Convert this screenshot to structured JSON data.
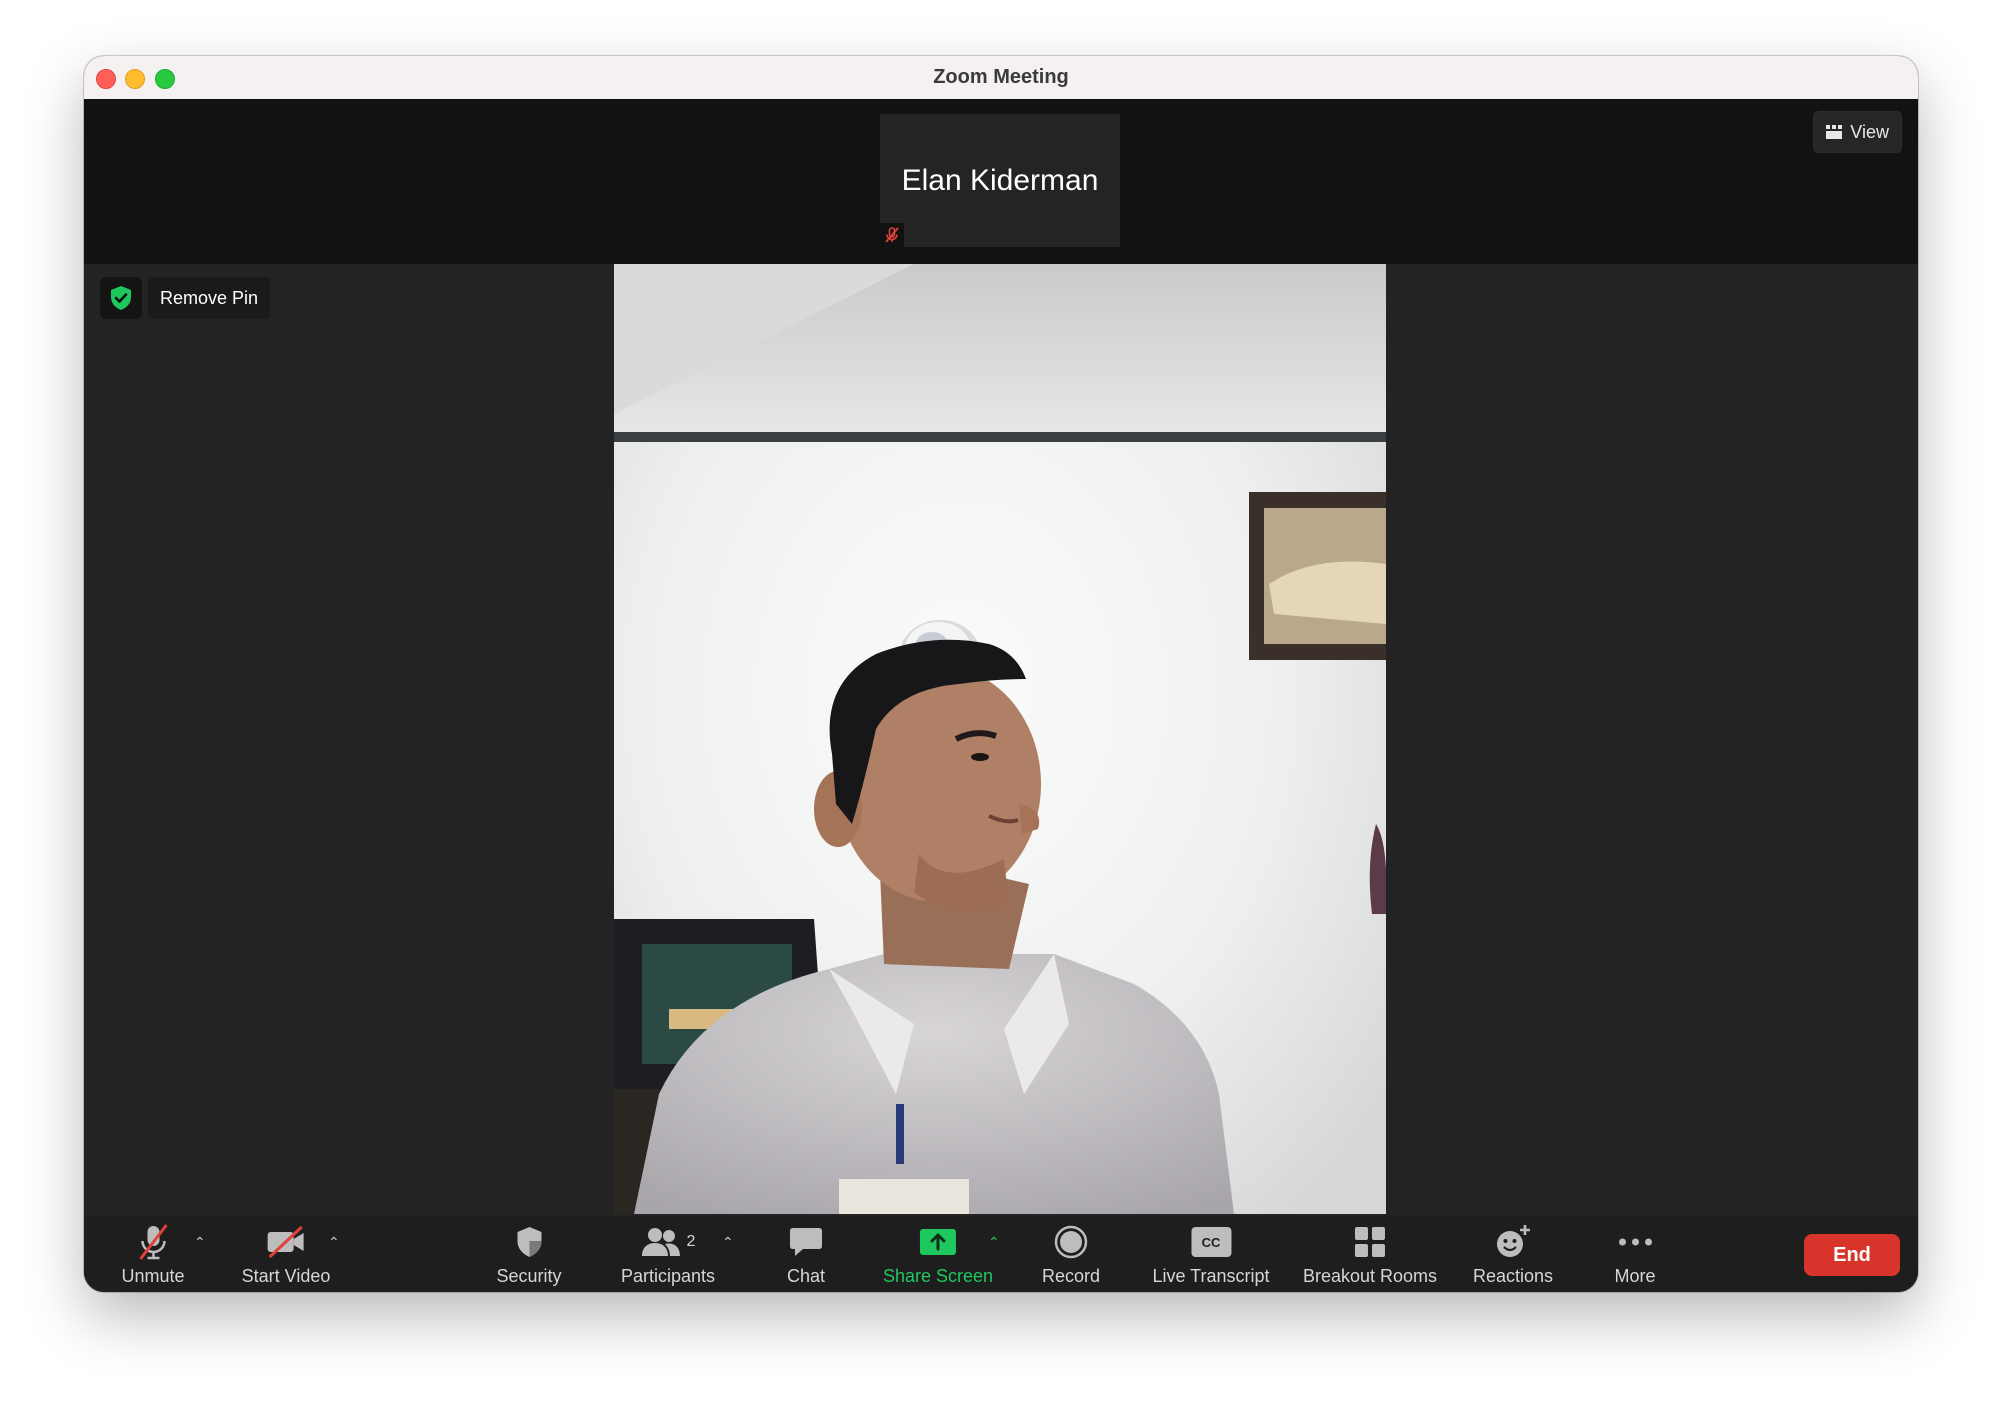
{
  "window": {
    "title": "Zoom Meeting"
  },
  "strip": {
    "participant_name": "Elan Kiderman",
    "view_label": "View"
  },
  "pin": {
    "label": "Remove Pin"
  },
  "toolbar": {
    "unmute": "Unmute",
    "start_video": "Start Video",
    "security": "Security",
    "participants": "Participants",
    "participants_count": "2",
    "chat": "Chat",
    "share_screen": "Share Screen",
    "record": "Record",
    "live_transcript": "Live Transcript",
    "breakout_rooms": "Breakout Rooms",
    "reactions": "Reactions",
    "more": "More",
    "end": "End"
  },
  "icons": {
    "cc_text": "CC"
  },
  "colors": {
    "accent_green": "#1ec85f",
    "end_red": "#d9342b",
    "mute_red": "#e0413a"
  }
}
